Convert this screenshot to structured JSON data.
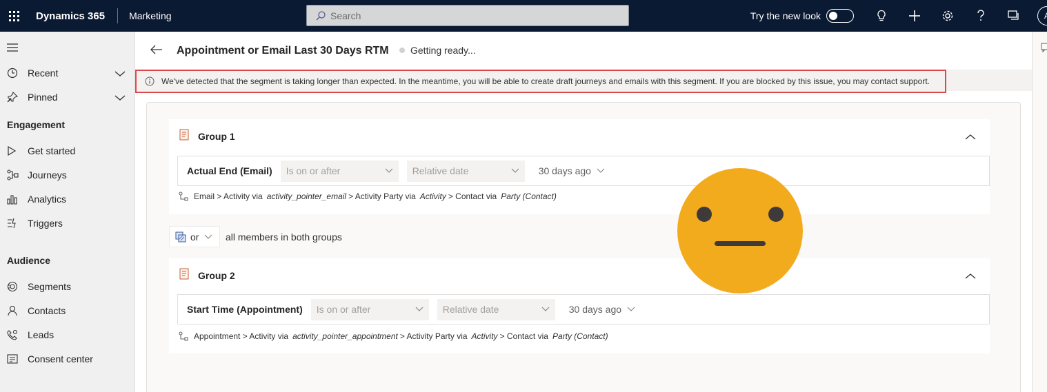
{
  "topbar": {
    "app_name": "Dynamics 365",
    "module": "Marketing",
    "search_placeholder": "Search",
    "try_new_look": "Try the new look",
    "avatar_initial": "A",
    "colors": {
      "background": "#0b1a33",
      "search_bg": "#d5d6d8"
    }
  },
  "sidebar": {
    "items_top": [
      {
        "label": "Recent",
        "icon": "clock-icon"
      },
      {
        "label": "Pinned",
        "icon": "pin-icon"
      }
    ],
    "engagement": {
      "heading": "Engagement",
      "items": [
        {
          "label": "Get started",
          "icon": "play-icon"
        },
        {
          "label": "Journeys",
          "icon": "journey-icon"
        },
        {
          "label": "Analytics",
          "icon": "analytics-icon"
        },
        {
          "label": "Triggers",
          "icon": "trigger-icon"
        }
      ]
    },
    "audience": {
      "heading": "Audience",
      "items": [
        {
          "label": "Segments",
          "icon": "segments-icon"
        },
        {
          "label": "Contacts",
          "icon": "person-icon"
        },
        {
          "label": "Leads",
          "icon": "leads-icon"
        },
        {
          "label": "Consent center",
          "icon": "consent-icon"
        }
      ]
    }
  },
  "header": {
    "title": "Appointment or Email Last 30 Days RTM",
    "status": "Getting ready..."
  },
  "warning": {
    "text": "We've detected that the segment is taking longer than expected. In the meantime, you will be able to create draft journeys and emails with this segment. If you are blocked by this issue, you may contact support.",
    "border_color": "#e0474c"
  },
  "groups": [
    {
      "title": "Group 1",
      "attribute": "Actual End (Email)",
      "operator": "Is on or after",
      "value_type": "Relative date",
      "value": "30 days ago",
      "path": [
        {
          "text": "Email > Activity via",
          "italic": false
        },
        {
          "text": "activity_pointer_email",
          "italic": true
        },
        {
          "text": "> Activity Party via",
          "italic": false
        },
        {
          "text": "Activity",
          "italic": true
        },
        {
          "text": "> Contact via",
          "italic": false
        },
        {
          "text": "Party (Contact)",
          "italic": true
        }
      ]
    },
    {
      "title": "Group 2",
      "attribute": "Start Time (Appointment)",
      "operator": "Is on or after",
      "value_type": "Relative date",
      "value": "30 days ago",
      "path": [
        {
          "text": "Appointment > Activity via",
          "italic": false
        },
        {
          "text": "activity_pointer_appointment",
          "italic": true
        },
        {
          "text": "> Activity Party via",
          "italic": false
        },
        {
          "text": "Activity",
          "italic": true
        },
        {
          "text": "> Contact via",
          "italic": false
        },
        {
          "text": "Party (Contact)",
          "italic": true
        }
      ]
    }
  ],
  "combinator": {
    "value": "or",
    "description": "all members in both groups"
  },
  "overlay": {
    "emoji": "neutral-face",
    "color": "#f3ab1e"
  }
}
